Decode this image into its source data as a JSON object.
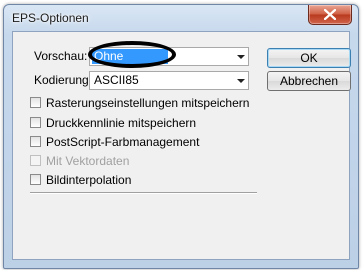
{
  "window": {
    "title": "EPS-Optionen"
  },
  "preview": {
    "label": "Vorschau:",
    "value": "Ohne"
  },
  "encoding": {
    "label": "Kodierung:",
    "value": "ASCII85"
  },
  "buttons": {
    "ok": "OK",
    "cancel": "Abbrechen"
  },
  "options": [
    {
      "label": "Rasterungseinstellungen mitspeichern",
      "checked": false,
      "enabled": true
    },
    {
      "label": "Druckkennlinie mitspeichern",
      "checked": false,
      "enabled": true
    },
    {
      "label": "PostScript-Farbmanagement",
      "checked": false,
      "enabled": true
    },
    {
      "label": "Mit Vektordaten",
      "checked": false,
      "enabled": false
    },
    {
      "label": "Bildinterpolation",
      "checked": false,
      "enabled": true
    }
  ],
  "colors": {
    "selection": "#3399ff",
    "close_button": "#c7503a",
    "title_bar": "#c6d8ec"
  },
  "icons": {
    "close": "close-icon",
    "dropdown": "chevron-down-icon"
  }
}
